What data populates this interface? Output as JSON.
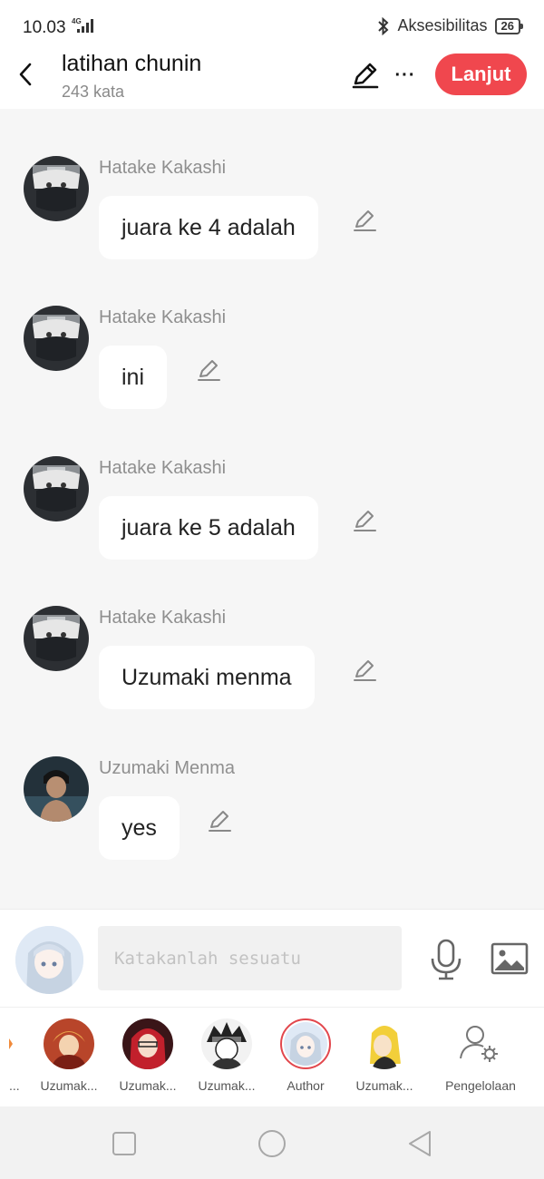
{
  "status": {
    "time": "10.03",
    "network": "4G",
    "accessibility": "Aksesibilitas",
    "battery": "26"
  },
  "header": {
    "title": "latihan chunin",
    "subtitle": "243 kata",
    "next_label": "Lanjut",
    "more_label": "···"
  },
  "messages": [
    {
      "sender": "Hatake Kakashi",
      "text": "juara ke 4 adalah"
    },
    {
      "sender": "Hatake Kakashi",
      "text": "ini"
    },
    {
      "sender": "Hatake Kakashi",
      "text": "juara ke 5 adalah"
    },
    {
      "sender": "Hatake Kakashi",
      "text": "Uzumaki menma"
    },
    {
      "sender": "Uzumaki Menma",
      "text": "yes"
    }
  ],
  "composer": {
    "placeholder": "Katakanlah sesuatu",
    "value": ""
  },
  "characters": [
    {
      "name": "..."
    },
    {
      "name": "Uzumak..."
    },
    {
      "name": "Uzumak..."
    },
    {
      "name": "Uzumak..."
    },
    {
      "name": "Author"
    },
    {
      "name": "Uzumak..."
    },
    {
      "name": "Pengelolaan"
    }
  ],
  "colors": {
    "accent": "#f0474e",
    "background": "#f6f6f6",
    "bubble": "#ffffff",
    "sender_text": "#8f8f8f"
  }
}
